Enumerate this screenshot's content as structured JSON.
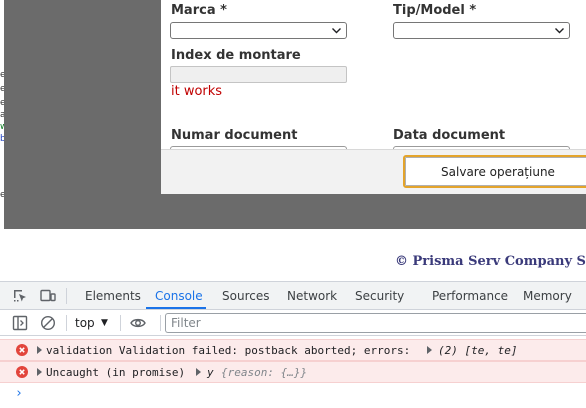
{
  "page": {
    "left_edge_fragments": [
      "e",
      "e",
      "e",
      "a",
      "w",
      "b",
      "e"
    ]
  },
  "modal": {
    "fields": {
      "marca_label": "Marca *",
      "tip_model_label": "Tip/Model *",
      "index_label": "Index de montare",
      "message": "it works",
      "numar_label": "Numar document",
      "data_label": "Data document"
    },
    "save_button": "Salvare operațiune"
  },
  "footer": {
    "copyright": "© Prisma Serv Company SRL I"
  },
  "devtools": {
    "tabs": [
      {
        "label": "Elements",
        "active": false
      },
      {
        "label": "Console",
        "active": true
      },
      {
        "label": "Sources",
        "active": false
      },
      {
        "label": "Network",
        "active": false
      },
      {
        "label": "Security",
        "active": false
      },
      {
        "label": "Performance",
        "active": false
      },
      {
        "label": "Memory",
        "active": false
      }
    ],
    "toolbar": {
      "context": "top",
      "filter_placeholder": "Filter"
    },
    "console": [
      {
        "level": "error",
        "text": "validation Validation failed: postback aborted; errors:",
        "object": "(2) [te, te]"
      },
      {
        "level": "error",
        "text": "Uncaught (in promise)",
        "object_prefix": "y",
        "object": "{reason: {…}}"
      }
    ],
    "prompt": "›"
  },
  "colors": {
    "accent": "#1a73e8",
    "error_bg": "#fcebeb",
    "error_icon": "#e2453c",
    "button_focus": "#e4a42b",
    "overlay": "#6b6b6b",
    "message": "#c00000"
  }
}
